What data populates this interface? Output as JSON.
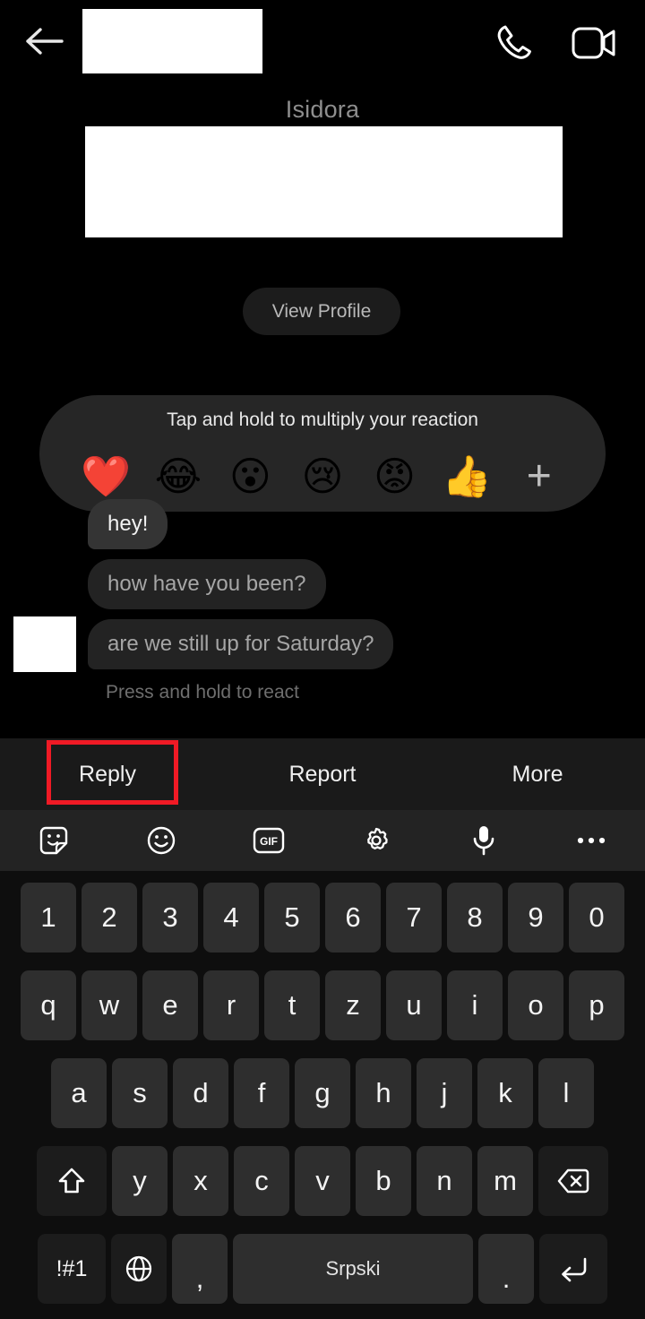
{
  "header": {
    "back_icon": "back-arrow-icon",
    "call_icon": "phone-icon",
    "video_icon": "video-camera-icon",
    "redacted_name_box": "redacted"
  },
  "profile": {
    "name": "Isidora",
    "view_profile_label": "View Profile"
  },
  "reaction_bar": {
    "hint": "Tap and hold to multiply your reaction",
    "emojis": [
      {
        "name": "heart-reaction",
        "glyph": "❤️"
      },
      {
        "name": "joy-reaction",
        "glyph": "😂"
      },
      {
        "name": "surprised-reaction",
        "glyph": "😮"
      },
      {
        "name": "crying-reaction",
        "glyph": "😢"
      },
      {
        "name": "angry-reaction",
        "glyph": "😡"
      },
      {
        "name": "thumbs-up-reaction",
        "glyph": "👍"
      }
    ],
    "add_label": "+"
  },
  "messages": {
    "items": [
      {
        "text": "hey!"
      },
      {
        "text": "how have you been?"
      },
      {
        "text": "are we still up for Saturday?"
      }
    ],
    "press_hold_hint": "Press and hold to react"
  },
  "action_bar": {
    "items": [
      {
        "label": "Reply",
        "selected": true
      },
      {
        "label": "Report",
        "selected": false
      },
      {
        "label": "More",
        "selected": false
      }
    ],
    "highlight_color": "#f01a25"
  },
  "keyboard_toolbar": {
    "items": [
      "sticker-icon",
      "emoji-icon",
      "gif-icon",
      "settings-gear-icon",
      "microphone-icon",
      "overflow-menu-icon"
    ],
    "gif_label": "GIF"
  },
  "keyboard": {
    "row_numbers": [
      "1",
      "2",
      "3",
      "4",
      "5",
      "6",
      "7",
      "8",
      "9",
      "0"
    ],
    "row_top": [
      "q",
      "w",
      "e",
      "r",
      "t",
      "z",
      "u",
      "i",
      "o",
      "p"
    ],
    "row_home": [
      "a",
      "s",
      "d",
      "f",
      "g",
      "h",
      "j",
      "k",
      "l"
    ],
    "row_bottom": [
      "y",
      "x",
      "c",
      "v",
      "b",
      "n",
      "m"
    ],
    "shift_label": "shift-icon",
    "backspace_label": "backspace-icon",
    "symbols_label": "!#1",
    "globe_label": "globe-icon",
    "comma_label": ",",
    "space_label": "Srpski",
    "period_label": ".",
    "enter_label": "enter-icon"
  },
  "colors": {
    "background": "#000000",
    "bubble": "#232323",
    "bubble_selected": "#343434",
    "reaction_bar": "#262626",
    "action_bar": "#1a1a1a",
    "toolbar": "#232323",
    "key": "#2e2e2e",
    "key_special": "#1c1c1c",
    "highlight": "#f01a25"
  }
}
